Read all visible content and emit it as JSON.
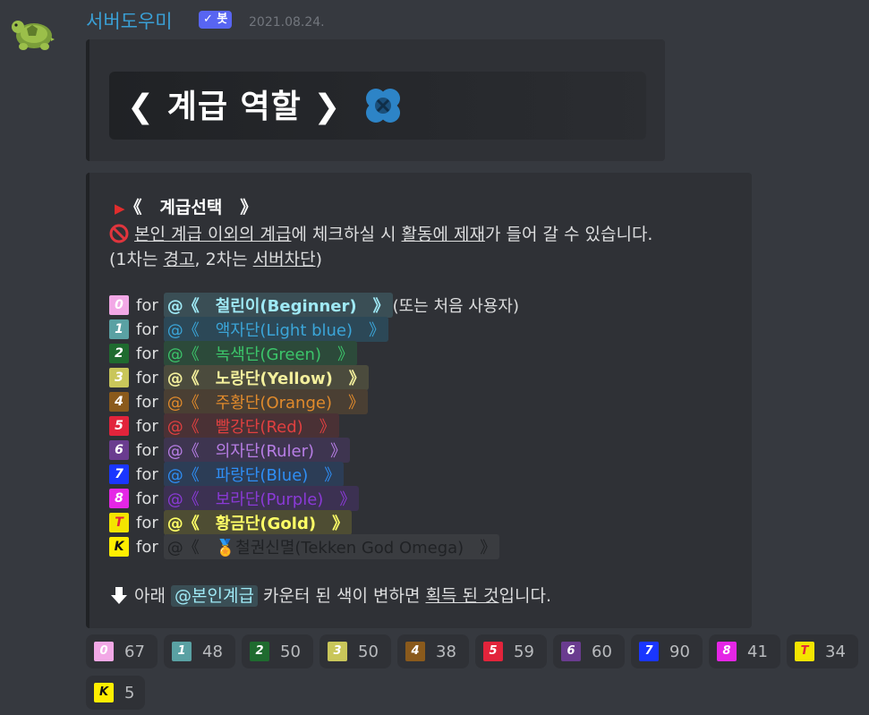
{
  "author": {
    "name": "서버도우미",
    "bot_badge": "✓ 봇",
    "timestamp": "2021.08.24.",
    "avatar_icon": "turtle-icon"
  },
  "embed1": {
    "banner_text": "❮ 계급 역할 ❯",
    "icon": "clover-icon"
  },
  "embed2": {
    "title": "계급선택",
    "title_arrow": "▶",
    "title_open": "《",
    "title_close": "》",
    "warn_icon": "no-entry-icon",
    "line1_a": "본인 계급 이외의 계급",
    "line1_b": "에 체크하실 시 ",
    "line1_c": "활동에 제재",
    "line1_d": "가 들어 갈 수 있습니다.",
    "line2_a": "(1차는 ",
    "line2_b": "경고",
    "line2_c": ", 2차는 ",
    "line2_d": "서버차단",
    "line2_e": ")",
    "for_label": "for",
    "roles": [
      {
        "badge": "0",
        "badge_color": "#f2a8e6",
        "text": "@《　철린이(Beginner)　》",
        "suffix": "(또는 처음 사용자)",
        "color": "#9fe9f5",
        "bg": "#3a4e55"
      },
      {
        "badge": "1",
        "badge_color": "#5aa1a3",
        "text": "@《　액자단(Light blue)　》",
        "suffix": "",
        "color": "#3ba5d8",
        "bg": "#2c4857"
      },
      {
        "badge": "2",
        "badge_color": "#1f6b2f",
        "text": "@《　녹색단(Green)　》",
        "suffix": "",
        "color": "#3cc46a",
        "bg": "#2c4a3a"
      },
      {
        "badge": "3",
        "badge_color": "#c9c65a",
        "text": "@《　노랑단(Yellow)　》",
        "suffix": "",
        "color": "#f3ef9c",
        "bg": "#4b4b3d"
      },
      {
        "badge": "4",
        "badge_color": "#8a5a1c",
        "text": "@《　주황단(Orange)　》",
        "suffix": "",
        "color": "#e08a2c",
        "bg": "#4a3f33"
      },
      {
        "badge": "5",
        "badge_color": "#e2243b",
        "text": "@《　빨강단(Red)　》",
        "suffix": "",
        "color": "#e04040",
        "bg": "#4a3135"
      },
      {
        "badge": "6",
        "badge_color": "#6a3c8f",
        "text": "@《　의자단(Ruler)　》",
        "suffix": "",
        "color": "#b87ee6",
        "bg": "#3e3550"
      },
      {
        "badge": "7",
        "badge_color": "#1a36ff",
        "text": "@《　파랑단(Blue)　》",
        "suffix": "",
        "color": "#2f8ef5",
        "bg": "#2c3d56"
      },
      {
        "badge": "8",
        "badge_color": "#e526e6",
        "text": "@《　보라단(Purple)　》",
        "suffix": "",
        "color": "#8a3ad6",
        "bg": "#3c3152"
      },
      {
        "badge": "T",
        "badge_color": "#f4e400",
        "text": "@《　황금단(Gold)　》",
        "suffix": "",
        "color": "#ffff66",
        "bg": "#4e4d33"
      },
      {
        "badge": "K",
        "badge_color": "#ffee00",
        "text": "@《　🏅철권신멸(Tekken God Omega)　》",
        "suffix": "",
        "color": "#202225",
        "bg": "#3a3c40"
      }
    ],
    "footer_icon": "down-arrow-icon",
    "footer_a": " 아래 ",
    "footer_mention": "@본인계급",
    "footer_b": " 카운터 된 색이 변하면 ",
    "footer_c": "획득 된 것",
    "footer_d": "입니다."
  },
  "reactions": [
    {
      "badge": "0",
      "color": "#f2a8e6",
      "count": "67"
    },
    {
      "badge": "1",
      "color": "#5aa1a3",
      "count": "48"
    },
    {
      "badge": "2",
      "color": "#1f6b2f",
      "count": "50"
    },
    {
      "badge": "3",
      "color": "#c9c65a",
      "count": "50"
    },
    {
      "badge": "4",
      "color": "#8a5a1c",
      "count": "38"
    },
    {
      "badge": "5",
      "color": "#e2243b",
      "count": "59"
    },
    {
      "badge": "6",
      "color": "#6a3c8f",
      "count": "60"
    },
    {
      "badge": "7",
      "color": "#1a36ff",
      "count": "90"
    },
    {
      "badge": "8",
      "color": "#e526e6",
      "count": "41"
    },
    {
      "badge": "T",
      "color": "#f4e400",
      "count": "34"
    },
    {
      "badge": "K",
      "color": "#ffee00",
      "count": "5"
    }
  ]
}
